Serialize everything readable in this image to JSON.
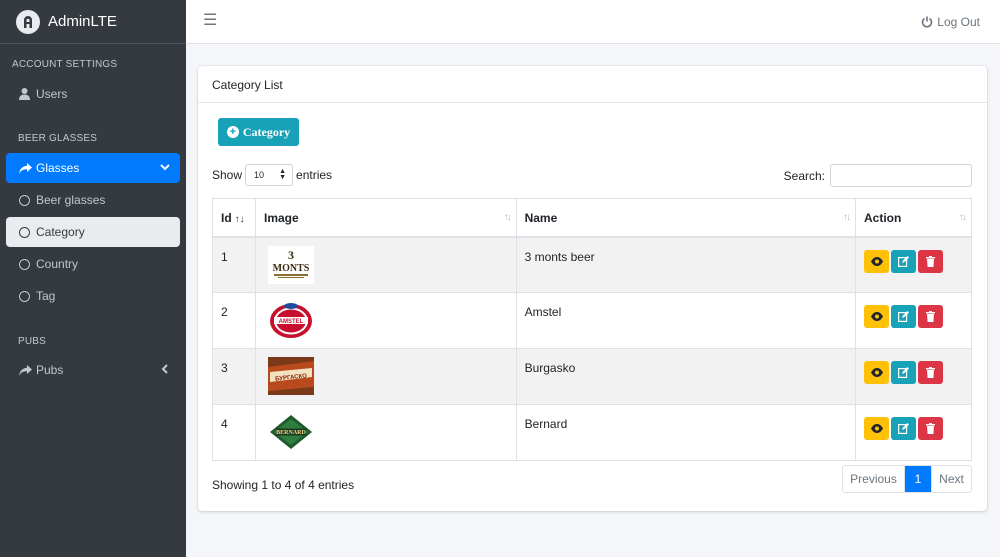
{
  "brand": {
    "name_bold": "Admin",
    "name_light": "LTE"
  },
  "sidebar": {
    "sections": [
      {
        "label": "ACCOUNT SETTINGS"
      },
      {
        "label": "BEER GLASSES"
      },
      {
        "label": "PUBS"
      }
    ],
    "items": [
      {
        "label": "Users",
        "icon": "user-icon"
      },
      {
        "label": "Glasses",
        "icon": "share-icon",
        "active": true
      },
      {
        "label": "Beer glasses",
        "icon": "circle-icon"
      },
      {
        "label": "Category",
        "icon": "circle-icon",
        "selected": true
      },
      {
        "label": "Country",
        "icon": "circle-icon"
      },
      {
        "label": "Tag",
        "icon": "circle-icon"
      },
      {
        "label": "Pubs",
        "icon": "share-icon"
      }
    ]
  },
  "topbar": {
    "logout_label": "Log Out"
  },
  "card": {
    "title": "Category List",
    "add_button": "Category"
  },
  "table_controls": {
    "show_label": "Show",
    "entries_value": "10",
    "entries_label": "entries",
    "search_label": "Search:",
    "search_value": ""
  },
  "table": {
    "headers": [
      "Id",
      "Image",
      "Name",
      "Action"
    ],
    "rows": [
      {
        "id": "1",
        "name": "3 monts beer",
        "logo": "3 MONTS"
      },
      {
        "id": "2",
        "name": "Amstel",
        "logo": "AMSTEL"
      },
      {
        "id": "3",
        "name": "Burgasko",
        "logo": "БУРГАСКО"
      },
      {
        "id": "4",
        "name": "Bernard",
        "logo": "BERNARD"
      }
    ]
  },
  "footer": {
    "info": "Showing 1 to 4 of 4 entries",
    "prev": "Previous",
    "page": "1",
    "next": "Next"
  },
  "colors": {
    "sidebar": "#343a40",
    "primary": "#007bff",
    "info": "#17a2b8",
    "warning": "#ffc107",
    "danger": "#dc3545"
  }
}
